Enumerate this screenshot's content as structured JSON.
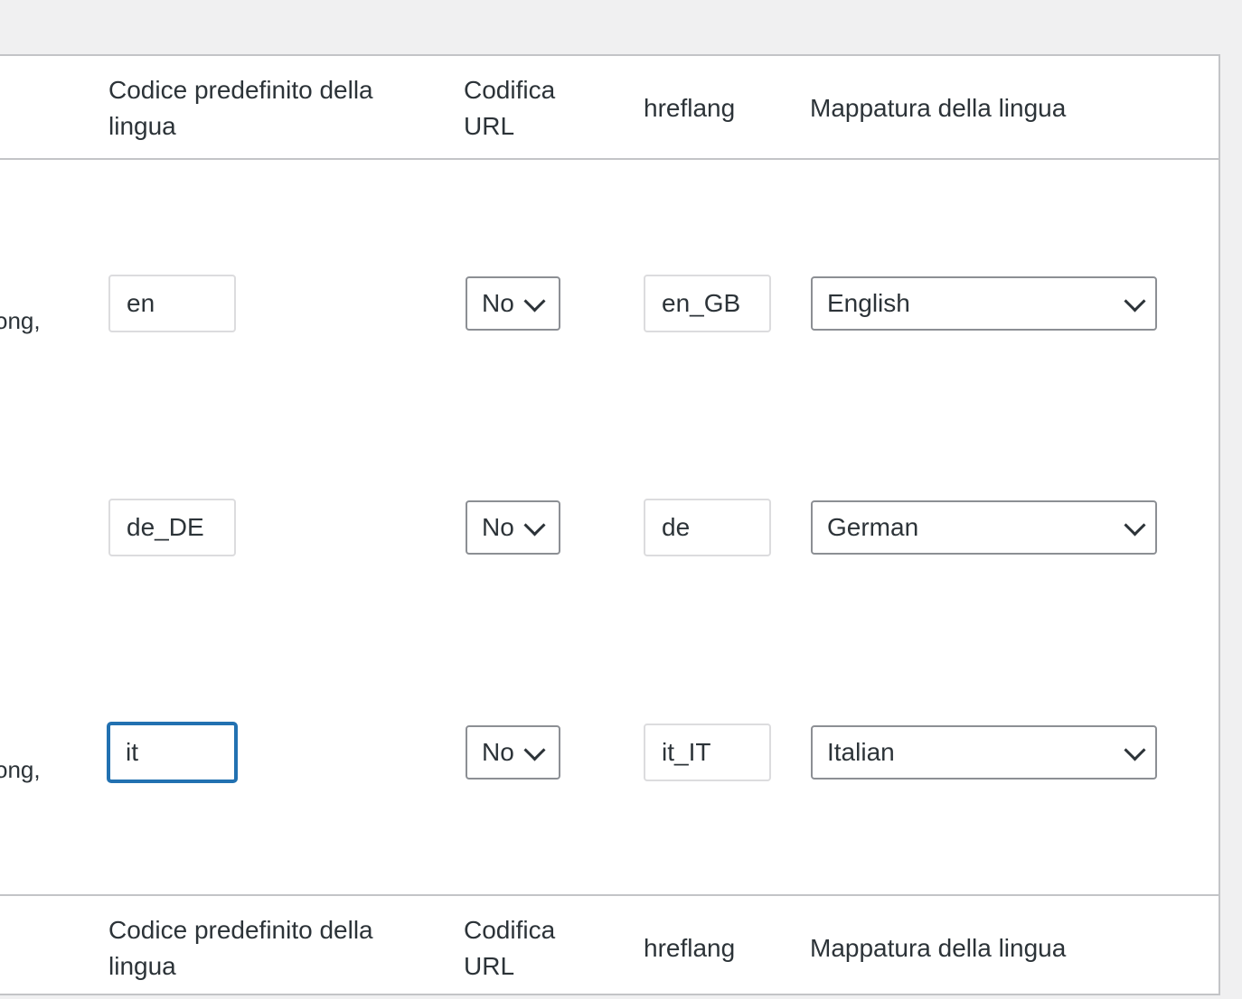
{
  "headers": {
    "code": "Codice predefinito della lingua",
    "url_encoding": "Codifica URL",
    "hreflang": "hreflang",
    "mapping": "Mappatura della lingua"
  },
  "rows": [
    {
      "cut_text": "ong,",
      "code": "en",
      "url_encoding": "No",
      "hreflang": "en_GB",
      "mapping": "English",
      "focused": false
    },
    {
      "cut_text": "",
      "code": "de_DE",
      "url_encoding": "No",
      "hreflang": "de",
      "mapping": "German",
      "focused": false
    },
    {
      "cut_text": "ong,",
      "code": "it",
      "url_encoding": "No",
      "hreflang": "it_IT",
      "mapping": "Italian",
      "focused": true
    }
  ],
  "colors": {
    "focus": "#2271b1",
    "border": "#c3c4c7",
    "text": "#2c3338"
  }
}
